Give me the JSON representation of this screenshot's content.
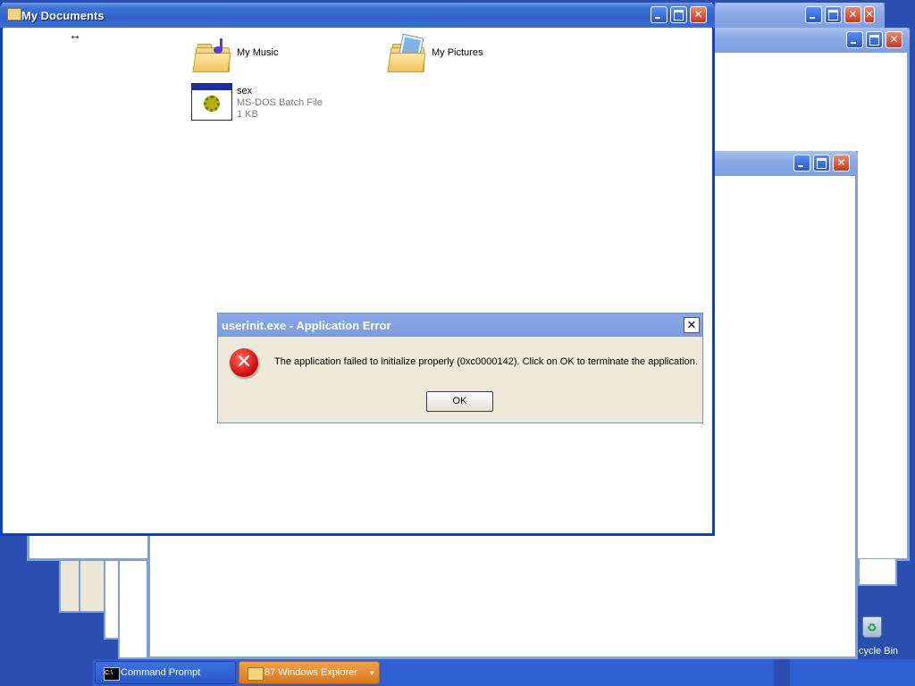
{
  "main_window": {
    "title": "My Documents",
    "items": [
      {
        "name": "My Music"
      },
      {
        "name": "My Pictures"
      },
      {
        "name": "sex",
        "type": "MS-DOS Batch File",
        "size": "1 KB"
      }
    ]
  },
  "dialog": {
    "title": "userinit.exe - Application Error",
    "message": "The application failed to initialize properly (0xc0000142). Click on OK to terminate the application.",
    "ok_label": "OK"
  },
  "taskbar": {
    "buttons": [
      {
        "label": "Command Prompt"
      },
      {
        "label": "87 Windows Explorer",
        "has_dropdown": true
      }
    ]
  },
  "desktop": {
    "recycle_bin_label": "cycle Bin"
  },
  "colors": {
    "desktop": "#2a4fb0",
    "title_active": "#2f63cc",
    "title_inactive": "#8aa9e6",
    "taskbar": "#2f5fd0",
    "explorer_group_button": "#e5892b",
    "dialog_face": "#ece9d8",
    "error_red": "#d10d0d"
  },
  "icons": [
    "folder-music-icon",
    "folder-pictures-icon",
    "batch-file-icon",
    "error-icon",
    "command-prompt-icon",
    "folder-icon",
    "recycle-bin-icon",
    "resize-cursor-icon"
  ]
}
